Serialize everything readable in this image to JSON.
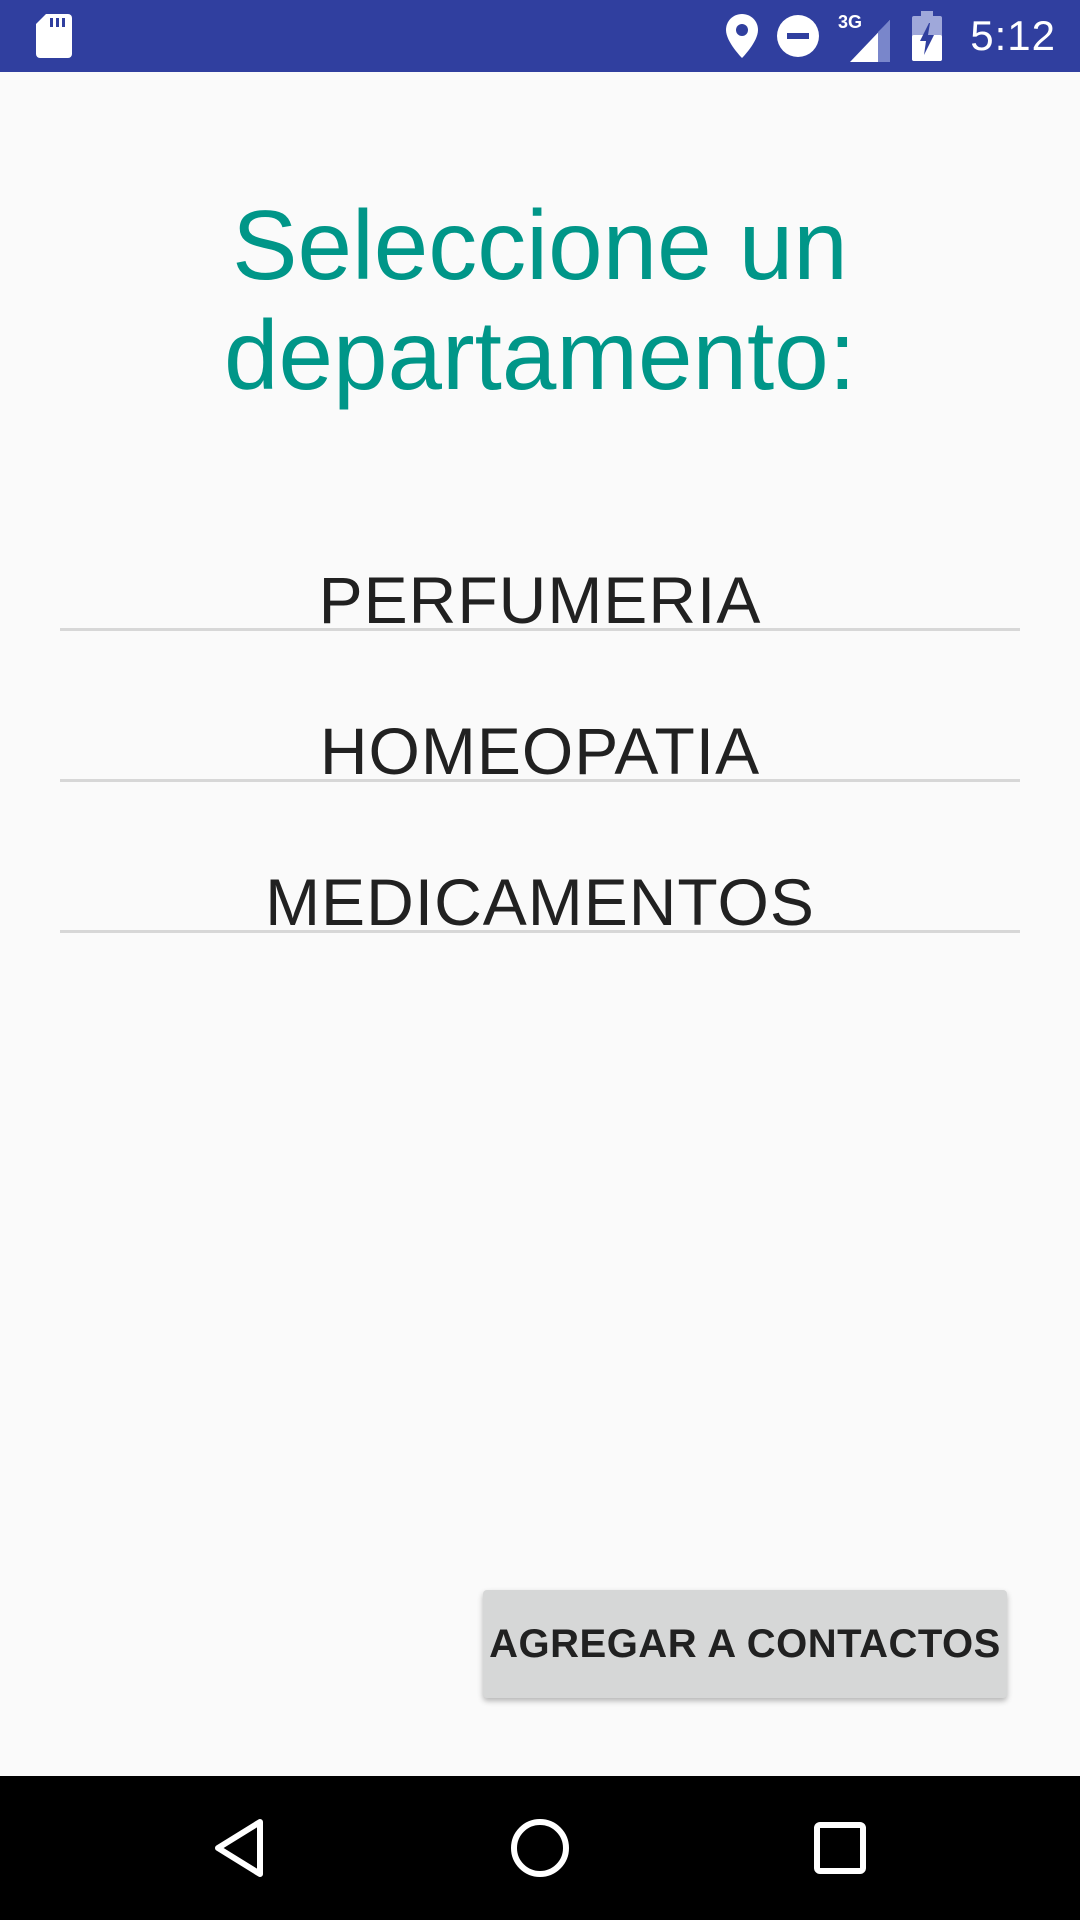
{
  "status_bar": {
    "time": "5:12",
    "network": "3G",
    "background_color": "#303f9f",
    "icons": [
      "sd-card-icon",
      "location-icon",
      "do-not-disturb-icon",
      "signal-3g-icon",
      "battery-charging-icon"
    ]
  },
  "main": {
    "title": "Seleccione un departamento:",
    "title_color": "#009688",
    "departments": [
      {
        "label": "PERFUMERIA"
      },
      {
        "label": "HOMEOPATIA"
      },
      {
        "label": "MEDICAMENTOS"
      }
    ],
    "add_button_label": "AGREGAR A CONTACTOS"
  },
  "nav_bar": {
    "icons": [
      "back-icon",
      "home-icon",
      "recents-icon"
    ]
  }
}
